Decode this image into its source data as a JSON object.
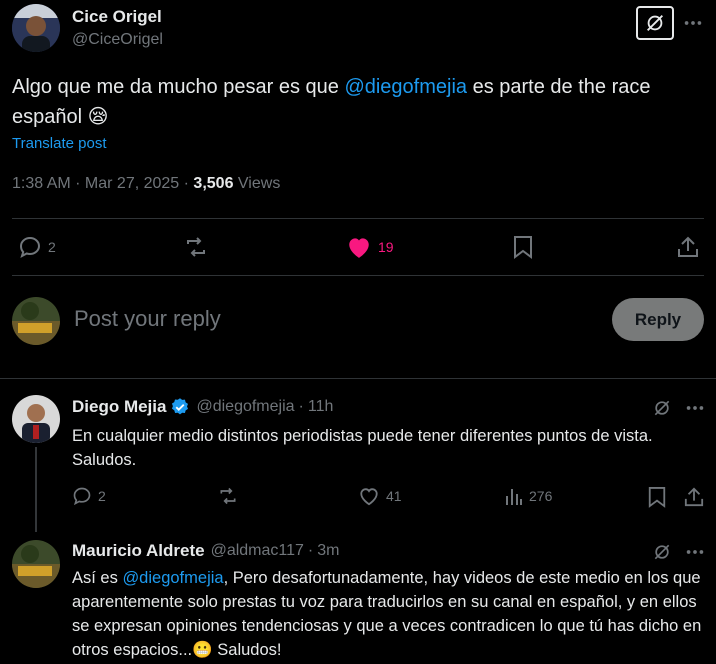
{
  "main_post": {
    "author_name": "Cice Origel",
    "author_handle": "@CiceOrigel",
    "text_before": "Algo que me da mucho pesar es que ",
    "mention": "@diegofmejia",
    "text_after": " es parte de the race español ",
    "emoji": "😪",
    "translate": "Translate post",
    "time": "1:38 AM",
    "date": "Mar 27, 2025",
    "views_count": "3,506",
    "views_label": "Views",
    "replies": "2",
    "likes": "19"
  },
  "composer": {
    "placeholder": "Post your reply",
    "button": "Reply"
  },
  "replies": [
    {
      "name": "Diego Mejia",
      "handle": "@diegofmejia",
      "time": "11h",
      "text": "En cualquier medio distintos periodistas puede tener diferentes puntos de vista. Saludos.",
      "replies": "2",
      "likes": "41",
      "views": "276"
    },
    {
      "name": "Mauricio Aldrete",
      "handle": "@aldmac117",
      "time": "3m",
      "text_prefix": "Así es ",
      "mention": "@diegofmejia",
      "text_body": ", Pero desafortunadamente, hay videos de este medio en los que aparentemente solo prestas tu voz para traducirlos en su canal en español, y en ellos se expresan opiniones tendenciosas y que a veces contradicen lo que tú has dicho en otros espacios...",
      "emoji": "😬",
      "text_end": " Saludos!"
    }
  ],
  "colors": {
    "background": "#000000",
    "text": "#e7e9ea",
    "muted": "#71767b",
    "link": "#1d9bf0",
    "like": "#f91880",
    "divider": "#2f3336"
  }
}
